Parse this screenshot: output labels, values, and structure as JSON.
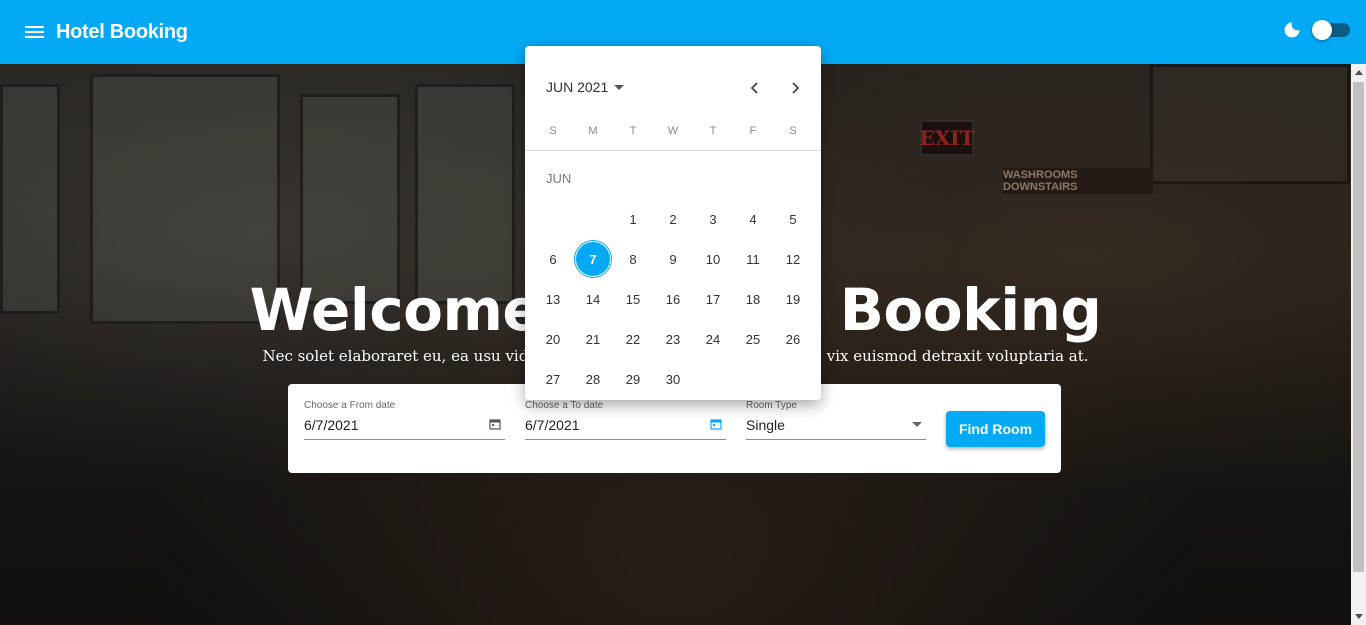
{
  "app": {
    "title": "Hotel Booking",
    "menu_icon": "menu-icon",
    "theme_icon": "moon-icon",
    "dark_mode_on": false
  },
  "hero": {
    "title": "Welcome to Hotel Booking",
    "subtitle": "Nec solet elaboraret eu, ea usu vidit accusam. Ea pri ullamcorper nec ex, vix euismod detraxit voluptaria at.",
    "signs": {
      "exit": "EXIT",
      "washroom": "WASHROOMS DOWNSTAIRS"
    }
  },
  "search": {
    "from": {
      "label": "Choose a From date",
      "value": "6/7/2021",
      "icon": "calendar-icon"
    },
    "to": {
      "label": "Choose a To date",
      "value": "6/7/2021",
      "icon": "calendar-icon"
    },
    "room_type": {
      "label": "Room Type",
      "value": "Single"
    },
    "submit_label": "Find Room",
    "accent": "#03a9f4"
  },
  "datepicker": {
    "period_label": "JUN 2021",
    "month_label": "JUN",
    "weekdays": [
      "S",
      "M",
      "T",
      "W",
      "T",
      "F",
      "S"
    ],
    "first_weekday_index": 2,
    "days": [
      "1",
      "2",
      "3",
      "4",
      "5",
      "6",
      "7",
      "8",
      "9",
      "10",
      "11",
      "12",
      "13",
      "14",
      "15",
      "16",
      "17",
      "18",
      "19",
      "20",
      "21",
      "22",
      "23",
      "24",
      "25",
      "26",
      "27",
      "28",
      "29",
      "30"
    ],
    "selected_day": "7"
  }
}
